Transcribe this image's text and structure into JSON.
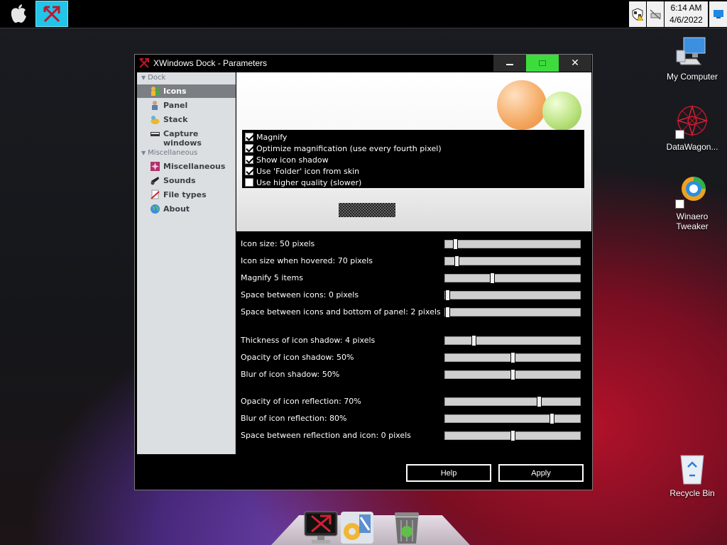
{
  "taskbar": {
    "apple_icon": "apple-logo-icon",
    "app_icon": "xwindows-dock-icon",
    "tray_icons": [
      "security-warning-icon",
      "network-offline-icon"
    ],
    "time": "6:14 AM",
    "date": "4/6/2022"
  },
  "desktop": {
    "icons": [
      {
        "label": "My Computer",
        "icon": "computer-icon"
      },
      {
        "label": "DataWagon...",
        "icon": "datawagon-icon"
      },
      {
        "label": "Winaero Tweaker",
        "icon": "winaero-tweaker-icon"
      },
      {
        "label": "Recycle Bin",
        "icon": "recycle-bin-icon"
      }
    ]
  },
  "window": {
    "title": "XWindows Dock - Parameters",
    "minimize": "—",
    "close": "✕",
    "accent_max": "#3ddc3d"
  },
  "sidebar": {
    "dock_header": "Dock",
    "dock_items": [
      {
        "label": "Icons",
        "icon": "people-icon"
      },
      {
        "label": "Panel",
        "icon": "panel-person-icon"
      },
      {
        "label": "Stack",
        "icon": "stack-icon"
      },
      {
        "label": "Capture windows",
        "icon": "keyboard-icon"
      }
    ],
    "misc_header": "Miscellaneous",
    "misc_items": [
      {
        "label": "Miscellaneous",
        "icon": "miscellaneous-icon"
      },
      {
        "label": "Sounds",
        "icon": "speaker-icon"
      },
      {
        "label": "File types",
        "icon": "file-types-icon"
      },
      {
        "label": "About",
        "icon": "globe-icon"
      }
    ]
  },
  "options": [
    {
      "label": "Magnify",
      "checked": true
    },
    {
      "label": "Optimize magnification (use every fourth pixel)",
      "checked": true
    },
    {
      "label": "Show icon shadow",
      "checked": true
    },
    {
      "label": "Use 'Folder' icon from skin",
      "checked": true
    },
    {
      "label": "Use higher quality (slower)",
      "checked": false
    }
  ],
  "preview": {
    "number": "2"
  },
  "sliders": [
    {
      "label": "Icon size: 50 pixels",
      "fraction": 0.06
    },
    {
      "label": "Icon size when hovered: 70 pixels",
      "fraction": 0.07
    },
    {
      "label": "Magnify 5 items",
      "fraction": 0.34
    },
    {
      "label": "Space between icons: 0 pixels",
      "fraction": 0.0
    },
    {
      "label": "Space between icons and bottom of panel: 2 pixels",
      "fraction": 0.0
    },
    {
      "label": "Thickness of icon shadow: 4 pixels",
      "fraction": 0.2
    },
    {
      "label": "Opacity of icon shadow: 50%",
      "fraction": 0.5
    },
    {
      "label": "Blur of icon shadow: 50%",
      "fraction": 0.5
    },
    {
      "label": "Opacity of icon reflection: 70%",
      "fraction": 0.7
    },
    {
      "label": "Blur of icon reflection: 80%",
      "fraction": 0.8
    },
    {
      "label": "Space between reflection and icon: 0 pixels",
      "fraction": 0.5
    }
  ],
  "buttons": {
    "help": "Help",
    "apply": "Apply"
  },
  "dock": {
    "items": [
      "xwindows-dock-icon",
      "settings-tools-icon",
      "trash-icon"
    ]
  }
}
